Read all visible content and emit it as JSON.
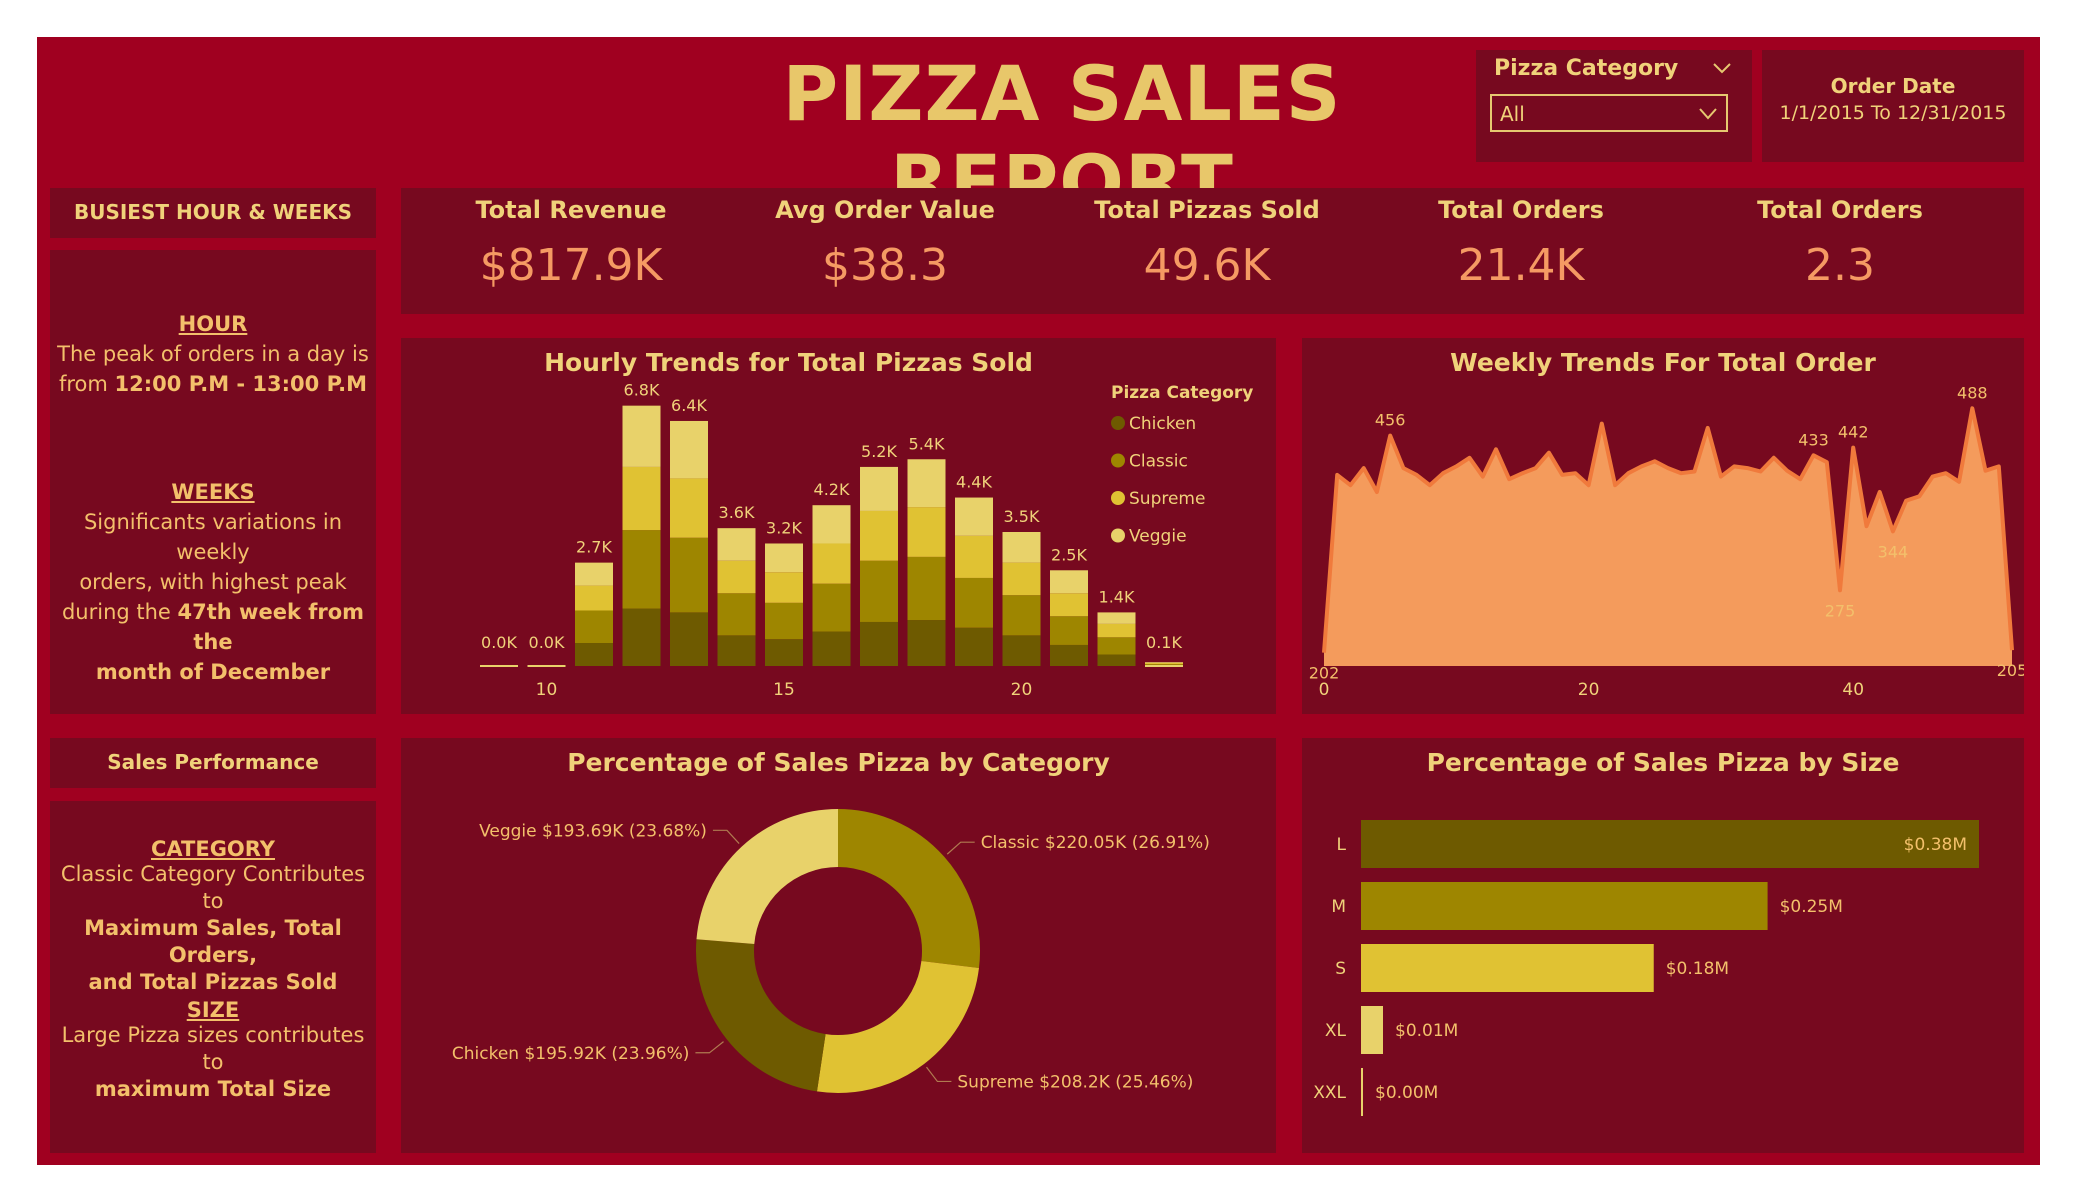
{
  "header": {
    "title": "PIZZA SALES REPORT"
  },
  "filters": {
    "category_label": "Pizza Category",
    "category_value": "All",
    "date_label": "Order Date",
    "date_value": "1/1/2015 To 12/31/2015"
  },
  "kpis": [
    {
      "label": "Total Revenue",
      "value": "$817.9K"
    },
    {
      "label": "Avg Order Value",
      "value": "$38.3"
    },
    {
      "label": "Total Pizzas Sold",
      "value": "49.6K"
    },
    {
      "label": "Total Orders",
      "value": "21.4K"
    },
    {
      "label": "Total Orders",
      "value": "2.3"
    }
  ],
  "sidebar": {
    "busiest_title": "BUSIEST HOUR & WEEKS",
    "hour_heading": "HOUR",
    "hour_text_1": "The peak of orders in a day is",
    "hour_text_2_prefix": "from ",
    "hour_text_2_bold": "12:00 P.M - 13:00 P.M",
    "weeks_heading": "WEEKS",
    "weeks_text_1": "Significants variations in weekly",
    "weeks_text_2": "orders, with highest peak",
    "weeks_text_3_prefix": "during the ",
    "weeks_text_3_bold": "47th week from the",
    "weeks_text_4_bold": "month of December",
    "perf_title": "Sales Performance",
    "category_heading": "CATEGORY",
    "category_text_1": "Classic Category Contributes to",
    "category_text_2_bold": "Maximum Sales, Total Orders,",
    "category_text_3_bold": "and Total Pizzas Sold",
    "size_heading": "SIZE",
    "size_text_1": "Large Pizza sizes contributes to",
    "size_text_2_bold": "maximum Total Size"
  },
  "colors": {
    "chicken": "#6e5a00",
    "classic": "#9e8600",
    "supreme": "#e0c233",
    "veggie": "#e8d26a",
    "area_fill": "#f49b5c",
    "area_line": "#f07a3c",
    "axis_text": "#f0d27a",
    "label_text": "#f3c06b"
  },
  "chart_data": [
    {
      "id": "hourly",
      "type": "bar",
      "title": "Hourly Trends for Total Pizzas Sold",
      "legend_title": "Pizza Category",
      "legend_position": "top-right",
      "stacked": true,
      "categories": [
        9,
        10,
        11,
        12,
        13,
        14,
        15,
        16,
        17,
        18,
        19,
        20,
        21,
        22,
        23
      ],
      "x_ticks": [
        10,
        15,
        20
      ],
      "totals": [
        0.0,
        0.0,
        2.7,
        6.8,
        6.4,
        3.6,
        3.2,
        4.2,
        5.2,
        5.4,
        4.4,
        3.5,
        2.5,
        1.4,
        0.1
      ],
      "total_labels": [
        "0.0K",
        "0.0K",
        "2.7K",
        "6.8K",
        "6.4K",
        "3.6K",
        "3.2K",
        "4.2K",
        "5.2K",
        "5.4K",
        "4.4K",
        "3.5K",
        "2.5K",
        "1.4K",
        "0.1K"
      ],
      "series": [
        {
          "name": "Chicken",
          "values": [
            0,
            0,
            0.6,
            1.5,
            1.4,
            0.8,
            0.7,
            0.9,
            1.15,
            1.2,
            1.0,
            0.8,
            0.55,
            0.3,
            0.02
          ]
        },
        {
          "name": "Classic",
          "values": [
            0,
            0,
            0.85,
            2.05,
            1.95,
            1.1,
            0.95,
            1.25,
            1.6,
            1.65,
            1.3,
            1.05,
            0.75,
            0.45,
            0.03
          ]
        },
        {
          "name": "Supreme",
          "values": [
            0,
            0,
            0.65,
            1.65,
            1.55,
            0.85,
            0.8,
            1.05,
            1.3,
            1.3,
            1.1,
            0.85,
            0.6,
            0.35,
            0.03
          ]
        },
        {
          "name": "Veggie",
          "values": [
            0,
            0,
            0.6,
            1.6,
            1.5,
            0.85,
            0.75,
            1.0,
            1.15,
            1.25,
            1.0,
            0.8,
            0.6,
            0.3,
            0.02
          ]
        }
      ],
      "ylim": [
        0,
        7
      ]
    },
    {
      "id": "weekly",
      "type": "area",
      "title": "Weekly Trends For Total Order",
      "x_ticks": [
        0,
        20,
        40
      ],
      "xlim": [
        0,
        52
      ],
      "ylim": [
        190,
        500
      ],
      "x": [
        0,
        1,
        2,
        3,
        4,
        5,
        6,
        7,
        8,
        9,
        10,
        11,
        12,
        13,
        14,
        15,
        16,
        17,
        18,
        19,
        20,
        21,
        22,
        23,
        24,
        25,
        26,
        27,
        28,
        29,
        30,
        31,
        32,
        33,
        34,
        35,
        36,
        37,
        38,
        39,
        40,
        41,
        42,
        43,
        44,
        45,
        46,
        47,
        48,
        49,
        50,
        51,
        52
      ],
      "values": [
        202,
        410,
        398,
        418,
        390,
        456,
        418,
        410,
        398,
        412,
        420,
        430,
        408,
        440,
        405,
        412,
        418,
        436,
        410,
        412,
        398,
        470,
        398,
        412,
        420,
        426,
        418,
        412,
        414,
        465,
        408,
        420,
        418,
        414,
        430,
        415,
        405,
        433,
        425,
        275,
        442,
        350,
        390,
        344,
        380,
        385,
        408,
        412,
        402,
        488,
        415,
        420,
        205
      ],
      "point_labels": [
        {
          "x": 0,
          "text": "202"
        },
        {
          "x": 5,
          "text": "456"
        },
        {
          "x": 37,
          "text": "433"
        },
        {
          "x": 39,
          "text": "275"
        },
        {
          "x": 40,
          "text": "442"
        },
        {
          "x": 43,
          "text": "344"
        },
        {
          "x": 49,
          "text": "488"
        },
        {
          "x": 52,
          "text": "205"
        }
      ]
    },
    {
      "id": "category",
      "type": "pie",
      "title": "Percentage of Sales Pizza by Category",
      "donut": true,
      "slices": [
        {
          "name": "Classic",
          "value": 26.91,
          "label": "Classic $220.05K (26.91%)"
        },
        {
          "name": "Supreme",
          "value": 25.46,
          "label": "Supreme $208.2K (25.46%)"
        },
        {
          "name": "Chicken",
          "value": 23.96,
          "label": "Chicken $195.92K (23.96%)"
        },
        {
          "name": "Veggie",
          "value": 23.68,
          "label": "Veggie $193.69K (23.68%)"
        }
      ]
    },
    {
      "id": "size",
      "type": "bar",
      "orientation": "horizontal",
      "title": "Percentage of Sales Pizza by Size",
      "categories": [
        "L",
        "M",
        "S",
        "XL",
        "XXL"
      ],
      "values": [
        0.38,
        0.25,
        0.18,
        0.01,
        0.0
      ],
      "value_labels": [
        "$0.38M",
        "$0.25M",
        "$0.18M",
        "$0.01M",
        "$0.00M"
      ],
      "bar_colors": [
        "#6e5a00",
        "#9e8600",
        "#e0c233",
        "#e8d26a",
        "#e8d26a"
      ],
      "xlim": [
        0,
        0.4
      ]
    }
  ]
}
